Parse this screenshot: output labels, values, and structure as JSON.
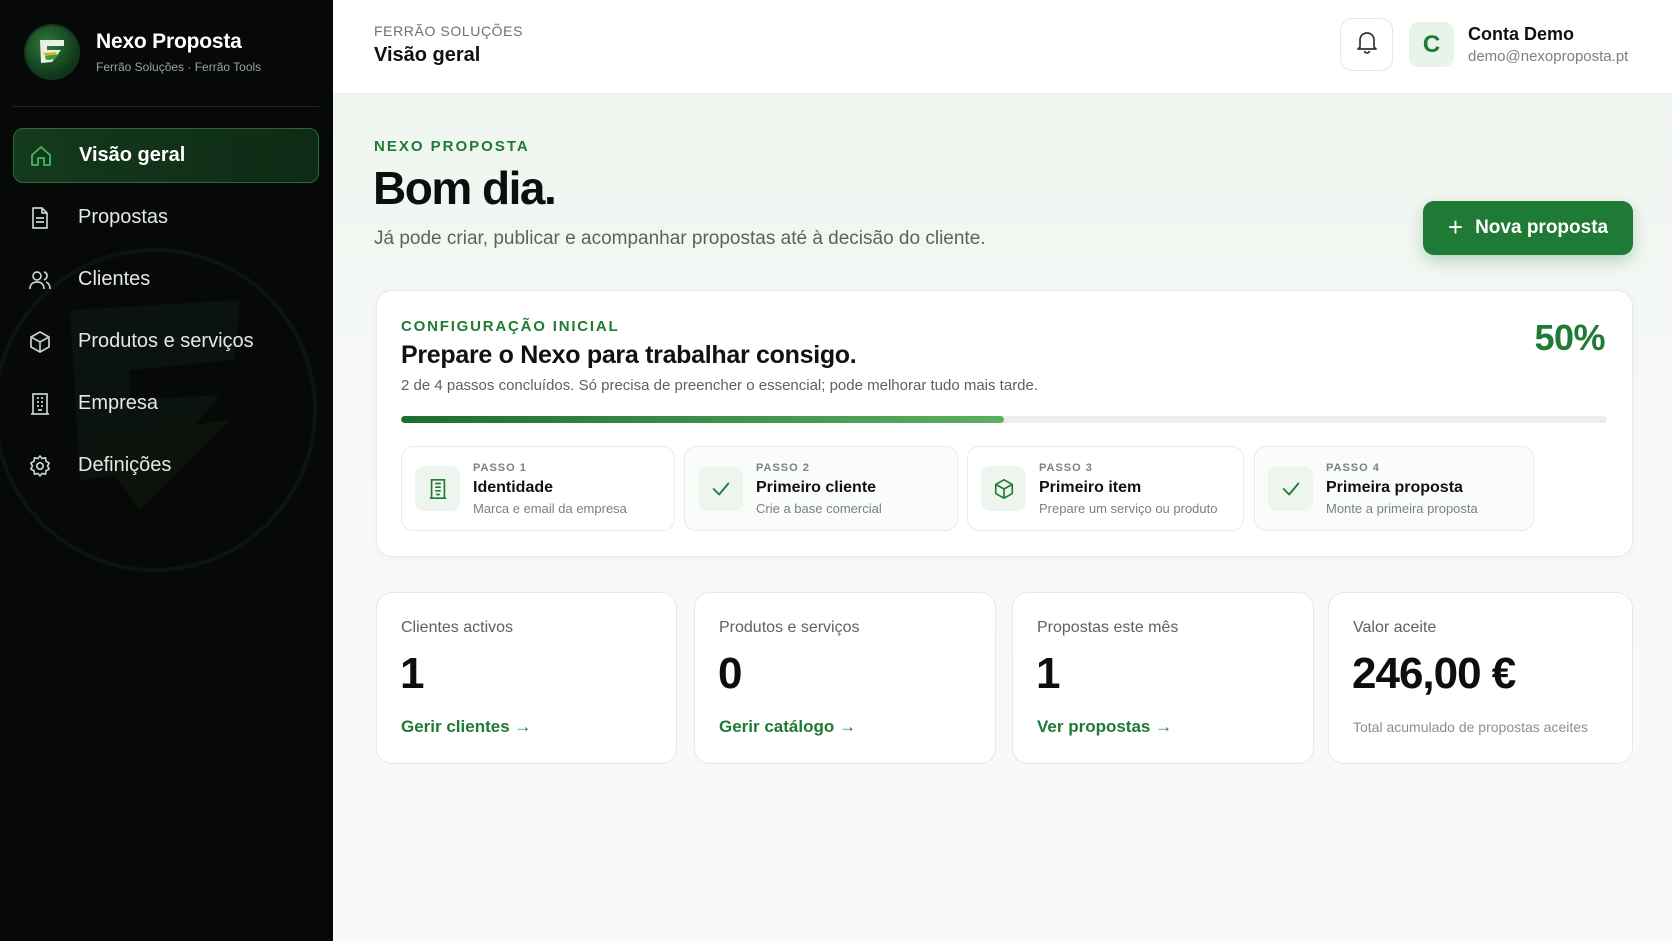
{
  "brand": {
    "name": "Nexo Proposta",
    "subtitle": "Ferrão Soluções · Ferrão Tools"
  },
  "nav": {
    "items": [
      {
        "label": "Visão geral",
        "icon": "home-icon",
        "active": true
      },
      {
        "label": "Propostas",
        "icon": "document-icon"
      },
      {
        "label": "Clientes",
        "icon": "users-icon"
      },
      {
        "label": "Produtos e serviços",
        "icon": "box-icon"
      },
      {
        "label": "Empresa",
        "icon": "building-icon"
      },
      {
        "label": "Definições",
        "icon": "gear-icon"
      }
    ]
  },
  "header": {
    "breadcrumb": "FERRÃO SOLUÇÕES",
    "title": "Visão geral",
    "bell_icon": "bell-icon",
    "user": {
      "initial": "C",
      "name": "Conta Demo",
      "email": "demo@nexoproposta.pt"
    }
  },
  "hero": {
    "eyebrow": "NEXO PROPOSTA",
    "greeting": "Bom dia.",
    "subtitle": "Já pode criar, publicar e acompanhar propostas até à decisão do cliente.",
    "new_button": "Nova proposta"
  },
  "setup": {
    "eyebrow": "CONFIGURAÇÃO INICIAL",
    "title": "Prepare o Nexo para trabalhar consigo.",
    "description": "2 de 4 passos concluídos. Só precisa de preencher o essencial; pode melhorar tudo mais tarde.",
    "percent": "50%",
    "progress": 0.5,
    "steps": [
      {
        "label": "PASSO 1",
        "title": "Identidade",
        "desc": "Marca e email da empresa",
        "icon": "building-icon",
        "done": false
      },
      {
        "label": "PASSO 2",
        "title": "Primeiro cliente",
        "desc": "Crie a base comercial",
        "icon": "check-icon",
        "done": true
      },
      {
        "label": "PASSO 3",
        "title": "Primeiro item",
        "desc": "Prepare um serviço ou produto",
        "icon": "box-icon",
        "done": false
      },
      {
        "label": "PASSO 4",
        "title": "Primeira proposta",
        "desc": "Monte a primeira proposta",
        "icon": "check-icon",
        "done": true
      }
    ]
  },
  "stats": [
    {
      "label": "Clientes activos",
      "value": "1",
      "link": "Gerir clientes →"
    },
    {
      "label": "Produtos e serviços",
      "value": "0",
      "link": "Gerir catálogo →"
    },
    {
      "label": "Propostas este mês",
      "value": "1",
      "link": "Ver propostas →"
    },
    {
      "label": "Valor aceite",
      "value": "246,00 €",
      "note": "Total acumulado de propostas aceites"
    }
  ],
  "colors": {
    "accent": "#1e7a34",
    "sidebar": "#060907",
    "background": "#f5f7f5"
  }
}
